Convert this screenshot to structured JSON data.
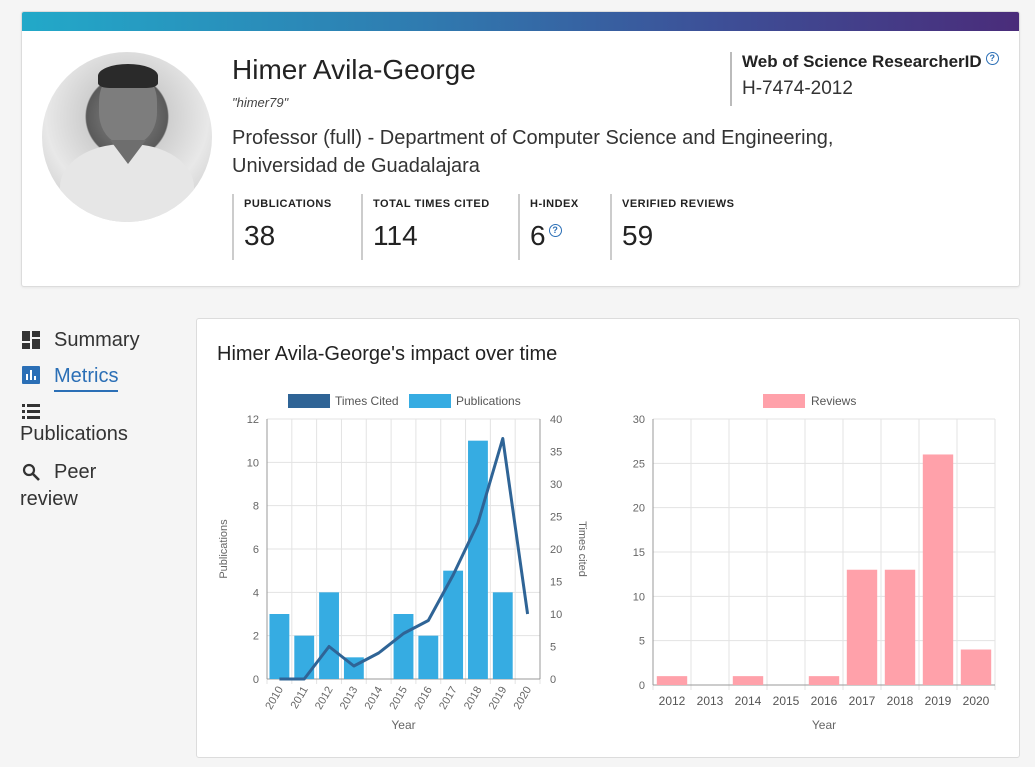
{
  "profile": {
    "name": "Himer Avila-George",
    "nickname": "\"himer79\"",
    "position": "Professor (full) - Department of Computer Science and Engineering, Universidad de Guadalajara",
    "researcher_id_label": "Web of Science ResearcherID",
    "researcher_id": "H-7474-2012",
    "help_glyph": "?",
    "stats": [
      {
        "label": "PUBLICATIONS",
        "value": "38"
      },
      {
        "label": "TOTAL TIMES CITED",
        "value": "114"
      },
      {
        "label": "H-INDEX",
        "value": "6"
      },
      {
        "label": "VERIFIED REVIEWS",
        "value": "59"
      }
    ]
  },
  "sidebar": {
    "items": [
      {
        "label": "Summary",
        "icon": "dashboard-icon"
      },
      {
        "label": "Metrics",
        "icon": "bar-chart-icon",
        "active": true
      },
      {
        "label": "Publications",
        "icon": "list-icon"
      },
      {
        "label": "Peer review",
        "icon": "search-icon"
      }
    ]
  },
  "metrics": {
    "title": "Himer Avila-George's impact over time"
  },
  "colors": {
    "accent": "#2b6fb6",
    "times_cited": "#2f6496",
    "publications": "#36ace2",
    "reviews": "#ffa1aa"
  },
  "chart_data": [
    {
      "type": "bar",
      "categories": [
        "2010",
        "2011",
        "2012",
        "2013",
        "2014",
        "2015",
        "2016",
        "2017",
        "2018",
        "2019",
        "2020"
      ],
      "series": [
        {
          "name": "Publications",
          "type": "bar",
          "axis": "left",
          "values": [
            3,
            2,
            4,
            1,
            0,
            3,
            2,
            5,
            11,
            4,
            0
          ]
        },
        {
          "name": "Times Cited",
          "type": "line",
          "axis": "right",
          "values": [
            0,
            0,
            5,
            2,
            4,
            7,
            9,
            16,
            24,
            37,
            10
          ]
        }
      ],
      "xlabel": "Year",
      "ylabel": "Publications",
      "y2label": "Times cited",
      "ylim": [
        0,
        12
      ],
      "yticks": [
        0,
        2,
        4,
        6,
        8,
        10,
        12
      ],
      "y2lim": [
        0,
        40
      ],
      "y2ticks": [
        0,
        5,
        10,
        15,
        20,
        25,
        30,
        35,
        40
      ],
      "grid": true,
      "legend": "top"
    },
    {
      "type": "bar",
      "categories": [
        "2012",
        "2013",
        "2014",
        "2015",
        "2016",
        "2017",
        "2018",
        "2019",
        "2020"
      ],
      "series": [
        {
          "name": "Reviews",
          "values": [
            1,
            0,
            1,
            0,
            1,
            13,
            13,
            26,
            4
          ]
        }
      ],
      "xlabel": "Year",
      "ylabel": "",
      "ylim": [
        0,
        30
      ],
      "yticks": [
        0,
        5,
        10,
        15,
        20,
        25,
        30
      ],
      "grid": true,
      "legend": "top"
    }
  ]
}
